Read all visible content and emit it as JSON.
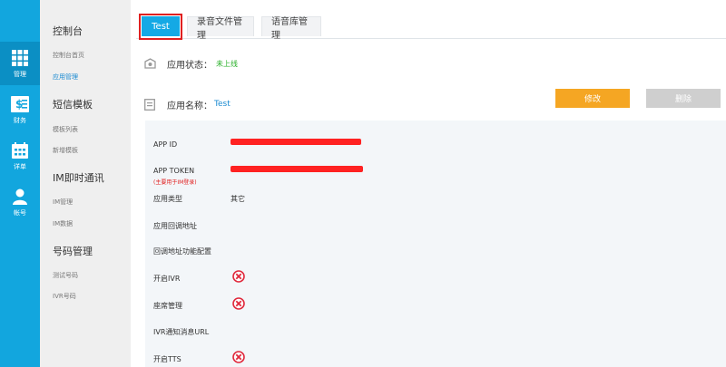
{
  "rail": {
    "items": [
      {
        "label": "管理",
        "icon": "grid-icon",
        "active": true
      },
      {
        "label": "财务",
        "icon": "finance-icon",
        "active": false
      },
      {
        "label": "详单",
        "icon": "calendar-icon",
        "active": false
      },
      {
        "label": "帐号",
        "icon": "user-icon",
        "active": false
      }
    ]
  },
  "sidebar": {
    "sections": [
      {
        "title": "控制台",
        "items": [
          {
            "label": "控制台首页",
            "active": false
          },
          {
            "label": "应用管理",
            "active": true
          }
        ]
      },
      {
        "title": "短信模板",
        "items": [
          {
            "label": "模板列表",
            "active": false
          },
          {
            "label": "新增模板",
            "active": false
          }
        ]
      },
      {
        "title": "IM即时通讯",
        "items": [
          {
            "label": "IM管理",
            "active": false
          },
          {
            "label": "IM数据",
            "active": false
          }
        ]
      },
      {
        "title": "号码管理",
        "items": [
          {
            "label": "测试号码",
            "active": false
          },
          {
            "label": "IVR号码",
            "active": false
          }
        ]
      }
    ]
  },
  "tabs": [
    {
      "label": "Test",
      "active": true
    },
    {
      "label": "录音文件管理",
      "active": false
    },
    {
      "label": "语音库管理",
      "active": false
    }
  ],
  "status": {
    "label": "应用状态：",
    "value": "未上线"
  },
  "app_name": {
    "label": "应用名称：",
    "value": "Test"
  },
  "buttons": {
    "edit": "修改",
    "delete": "删除"
  },
  "details": {
    "app_id_label": "APP ID",
    "app_token_label": "APP TOKEN",
    "app_token_note": "(主要用于IM登录)",
    "app_type_label": "应用类型",
    "app_type_value": "其它",
    "callback_label": "应用回调地址",
    "callback_config_label": "回调地址功能配置",
    "ivr_label": "开启IVR",
    "seat_label": "座席管理",
    "ivr_url_label": "IVR通知消息URL",
    "tts_label": "开启TTS"
  },
  "colors": {
    "rail": "#12a6de",
    "accent": "#14a9e5",
    "edit_button": "#f5a623",
    "delete_button": "#cfcfcf",
    "status_ok": "#2ab02a",
    "disabled_icon": "#e0283c",
    "redaction": "#ff2222"
  }
}
